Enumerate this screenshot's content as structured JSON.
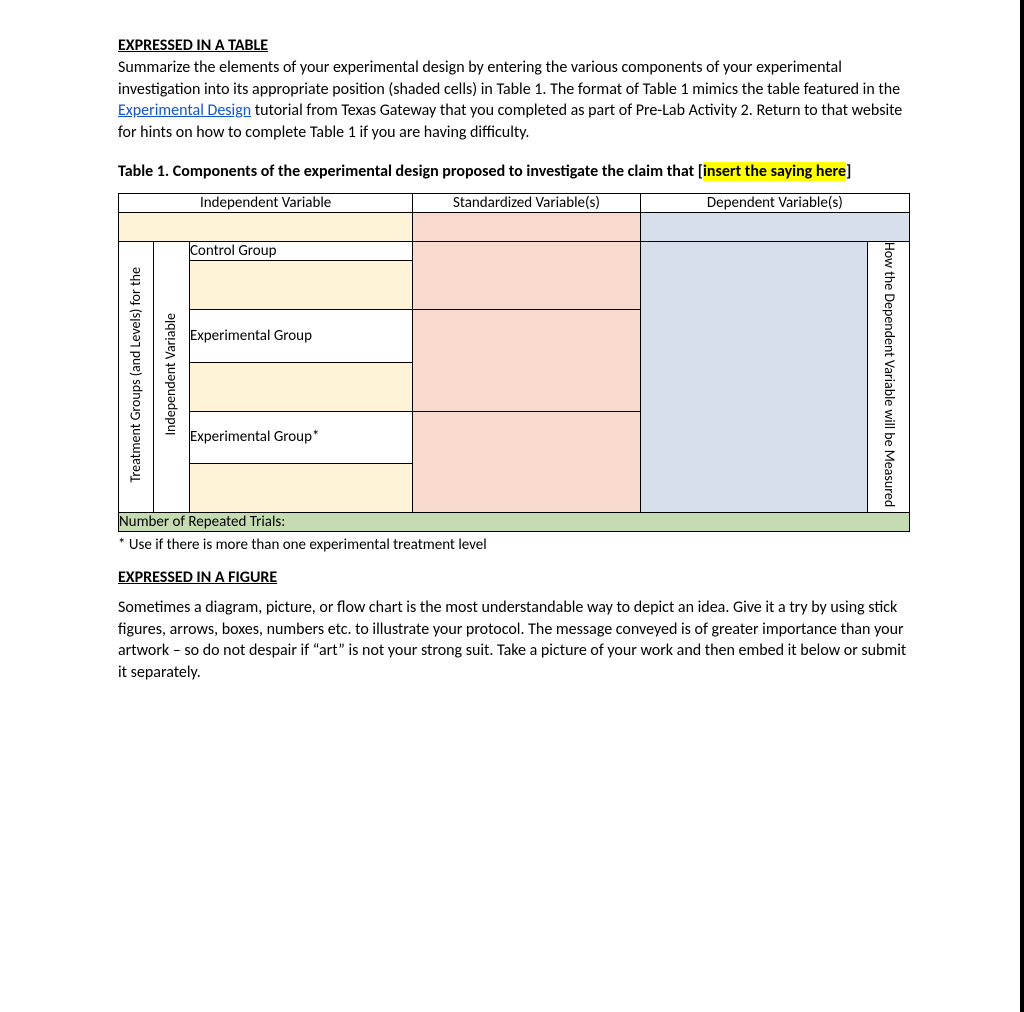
{
  "section1": {
    "title": "EXPRESSED IN A TABLE",
    "para_a": "Summarize the elements of your experimental design by entering the various components of your experimental investigation into its appropriate position (shaded cells) in Table 1.  The format of Table 1 mimics the table featured in the ",
    "link_text": "Experimental Design",
    "para_b": " tutorial from Texas Gateway that you completed as part of Pre-Lab Activity 2.  Return to that website for hints on how to complete Table 1 if you are having difficulty."
  },
  "caption": {
    "lead": "Table 1.  Components of the experimental design proposed to investigate the claim that ",
    "open_bracket": "[",
    "highlight": "insert the saying here",
    "close_bracket": "]"
  },
  "table": {
    "headers": {
      "iv": "Independent Variable",
      "sv": "Standardized Variable(s)",
      "dv": "Dependent Variable(s)"
    },
    "side_outer": "Treatment Groups (and Levels) for the",
    "side_inner": "Independent Variable",
    "rows": {
      "control": "Control Group",
      "exp1": "Experimental Group",
      "exp2": "Experimental Group*"
    },
    "right_label": "How the Dependent Variable will be Measured",
    "trials": "Number of Repeated Trials:",
    "footnote": "* Use if there is more than one experimental treatment level"
  },
  "section2": {
    "title": "EXPRESSED IN A FIGURE",
    "para": "Sometimes a diagram, picture, or flow chart is the most understandable way to depict an idea.  Give it a try by using stick figures, arrows, boxes, numbers etc. to illustrate your protocol.  The message conveyed is of greater importance than your artwork – so do not despair if “art” is not your strong suit.  Take a picture of your work and then embed it below or submit it separately."
  }
}
